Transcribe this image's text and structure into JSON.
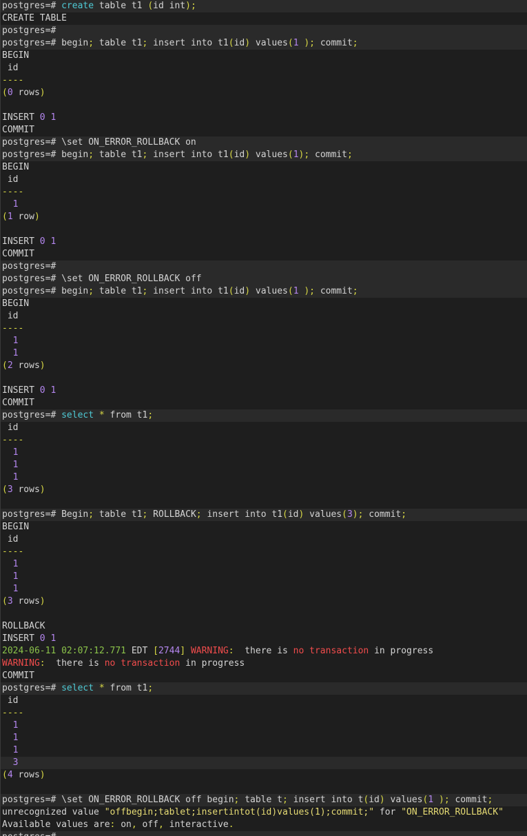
{
  "colors": {
    "background": "#1e1e1e",
    "highlight_row": "#2a2a2a",
    "text": "#d4d4d4",
    "keyword": "#4ec9d4",
    "punctuation": "#d8d845",
    "number": "#b587f0",
    "warning": "#f14c4c",
    "timestamp": "#8bc34a"
  },
  "lines": [
    {
      "hl": true,
      "segs": [
        [
          "prompt",
          "postgres=# "
        ],
        [
          "kw",
          "create"
        ],
        [
          "text",
          " table t1 "
        ],
        [
          "punct",
          "("
        ],
        [
          "text",
          "id int"
        ],
        [
          "punct",
          ");"
        ]
      ]
    },
    {
      "hl": false,
      "segs": [
        [
          "text",
          "CREATE TABLE"
        ]
      ]
    },
    {
      "hl": true,
      "segs": [
        [
          "prompt",
          "postgres=# "
        ]
      ]
    },
    {
      "hl": true,
      "segs": [
        [
          "prompt",
          "postgres=# "
        ],
        [
          "text",
          "begin"
        ],
        [
          "punct",
          ";"
        ],
        [
          "text",
          " table t1"
        ],
        [
          "punct",
          ";"
        ],
        [
          "text",
          " insert into t1"
        ],
        [
          "punct",
          "("
        ],
        [
          "text",
          "id"
        ],
        [
          "punct",
          ")"
        ],
        [
          "text",
          " values"
        ],
        [
          "punct",
          "("
        ],
        [
          "num",
          "1"
        ],
        [
          "punct",
          " );"
        ],
        [
          "text",
          " commit"
        ],
        [
          "punct",
          ";"
        ]
      ]
    },
    {
      "hl": false,
      "segs": [
        [
          "text",
          "BEGIN"
        ]
      ]
    },
    {
      "hl": false,
      "segs": [
        [
          "text",
          " id"
        ]
      ]
    },
    {
      "hl": false,
      "segs": [
        [
          "dim",
          "----"
        ]
      ]
    },
    {
      "hl": false,
      "segs": [
        [
          "punct",
          "("
        ],
        [
          "num",
          "0"
        ],
        [
          "text",
          " rows"
        ],
        [
          "punct",
          ")"
        ]
      ]
    },
    {
      "hl": false,
      "segs": [
        [
          "text",
          ""
        ]
      ]
    },
    {
      "hl": false,
      "segs": [
        [
          "text",
          "INSERT "
        ],
        [
          "num",
          "0 1"
        ]
      ]
    },
    {
      "hl": false,
      "segs": [
        [
          "text",
          "COMMIT"
        ]
      ]
    },
    {
      "hl": true,
      "segs": [
        [
          "prompt",
          "postgres=# "
        ],
        [
          "text",
          "\\set ON_ERROR_ROLLBACK on"
        ]
      ]
    },
    {
      "hl": true,
      "segs": [
        [
          "prompt",
          "postgres=# "
        ],
        [
          "text",
          "begin"
        ],
        [
          "punct",
          ";"
        ],
        [
          "text",
          " table t1"
        ],
        [
          "punct",
          ";"
        ],
        [
          "text",
          " insert into t1"
        ],
        [
          "punct",
          "("
        ],
        [
          "text",
          "id"
        ],
        [
          "punct",
          ")"
        ],
        [
          "text",
          " values"
        ],
        [
          "punct",
          "("
        ],
        [
          "num",
          "1"
        ],
        [
          "punct",
          ");"
        ],
        [
          "text",
          " commit"
        ],
        [
          "punct",
          ";"
        ]
      ]
    },
    {
      "hl": false,
      "segs": [
        [
          "text",
          "BEGIN"
        ]
      ]
    },
    {
      "hl": false,
      "segs": [
        [
          "text",
          " id"
        ]
      ]
    },
    {
      "hl": false,
      "segs": [
        [
          "dim",
          "----"
        ]
      ]
    },
    {
      "hl": false,
      "segs": [
        [
          "num",
          "  1"
        ]
      ]
    },
    {
      "hl": false,
      "segs": [
        [
          "punct",
          "("
        ],
        [
          "num",
          "1"
        ],
        [
          "text",
          " row"
        ],
        [
          "punct",
          ")"
        ]
      ]
    },
    {
      "hl": false,
      "segs": [
        [
          "text",
          ""
        ]
      ]
    },
    {
      "hl": false,
      "segs": [
        [
          "text",
          "INSERT "
        ],
        [
          "num",
          "0 1"
        ]
      ]
    },
    {
      "hl": false,
      "segs": [
        [
          "text",
          "COMMIT"
        ]
      ]
    },
    {
      "hl": true,
      "segs": [
        [
          "prompt",
          "postgres=# "
        ]
      ]
    },
    {
      "hl": true,
      "segs": [
        [
          "prompt",
          "postgres=# "
        ],
        [
          "text",
          "\\set ON_ERROR_ROLLBACK off"
        ]
      ]
    },
    {
      "hl": true,
      "segs": [
        [
          "prompt",
          "postgres=# "
        ],
        [
          "text",
          "begin"
        ],
        [
          "punct",
          ";"
        ],
        [
          "text",
          " table t1"
        ],
        [
          "punct",
          ";"
        ],
        [
          "text",
          " insert into t1"
        ],
        [
          "punct",
          "("
        ],
        [
          "text",
          "id"
        ],
        [
          "punct",
          ")"
        ],
        [
          "text",
          " values"
        ],
        [
          "punct",
          "("
        ],
        [
          "num",
          "1"
        ],
        [
          "punct",
          " );"
        ],
        [
          "text",
          " commit"
        ],
        [
          "punct",
          ";"
        ]
      ]
    },
    {
      "hl": false,
      "segs": [
        [
          "text",
          "BEGIN"
        ]
      ]
    },
    {
      "hl": false,
      "segs": [
        [
          "text",
          " id"
        ]
      ]
    },
    {
      "hl": false,
      "segs": [
        [
          "dim",
          "----"
        ]
      ]
    },
    {
      "hl": false,
      "segs": [
        [
          "num",
          "  1"
        ]
      ]
    },
    {
      "hl": false,
      "segs": [
        [
          "num",
          "  1"
        ]
      ]
    },
    {
      "hl": false,
      "segs": [
        [
          "punct",
          "("
        ],
        [
          "num",
          "2"
        ],
        [
          "text",
          " rows"
        ],
        [
          "punct",
          ")"
        ]
      ]
    },
    {
      "hl": false,
      "segs": [
        [
          "text",
          ""
        ]
      ]
    },
    {
      "hl": false,
      "segs": [
        [
          "text",
          "INSERT "
        ],
        [
          "num",
          "0 1"
        ]
      ]
    },
    {
      "hl": false,
      "segs": [
        [
          "text",
          "COMMIT"
        ]
      ]
    },
    {
      "hl": true,
      "segs": [
        [
          "prompt",
          "postgres=# "
        ],
        [
          "kw",
          "select"
        ],
        [
          "text",
          " "
        ],
        [
          "punct",
          "*"
        ],
        [
          "text",
          " from t1"
        ],
        [
          "punct",
          ";"
        ]
      ]
    },
    {
      "hl": false,
      "segs": [
        [
          "text",
          " id"
        ]
      ]
    },
    {
      "hl": false,
      "segs": [
        [
          "dim",
          "----"
        ]
      ]
    },
    {
      "hl": false,
      "segs": [
        [
          "num",
          "  1"
        ]
      ]
    },
    {
      "hl": false,
      "segs": [
        [
          "num",
          "  1"
        ]
      ]
    },
    {
      "hl": false,
      "segs": [
        [
          "num",
          "  1"
        ]
      ]
    },
    {
      "hl": false,
      "segs": [
        [
          "punct",
          "("
        ],
        [
          "num",
          "3"
        ],
        [
          "text",
          " rows"
        ],
        [
          "punct",
          ")"
        ]
      ]
    },
    {
      "hl": false,
      "segs": [
        [
          "text",
          ""
        ]
      ]
    },
    {
      "hl": true,
      "segs": [
        [
          "prompt",
          "postgres=# "
        ],
        [
          "text",
          "Begin"
        ],
        [
          "punct",
          ";"
        ],
        [
          "text",
          " table t1"
        ],
        [
          "punct",
          ";"
        ],
        [
          "text",
          " ROLLBACK"
        ],
        [
          "punct",
          ";"
        ],
        [
          "text",
          " insert into t1"
        ],
        [
          "punct",
          "("
        ],
        [
          "text",
          "id"
        ],
        [
          "punct",
          ")"
        ],
        [
          "text",
          " values"
        ],
        [
          "punct",
          "("
        ],
        [
          "num",
          "3"
        ],
        [
          "punct",
          ");"
        ],
        [
          "text",
          " commit"
        ],
        [
          "punct",
          ";"
        ]
      ]
    },
    {
      "hl": false,
      "segs": [
        [
          "text",
          "BEGIN"
        ]
      ]
    },
    {
      "hl": false,
      "segs": [
        [
          "text",
          " id"
        ]
      ]
    },
    {
      "hl": false,
      "segs": [
        [
          "dim",
          "----"
        ]
      ]
    },
    {
      "hl": false,
      "segs": [
        [
          "num",
          "  1"
        ]
      ]
    },
    {
      "hl": false,
      "segs": [
        [
          "num",
          "  1"
        ]
      ]
    },
    {
      "hl": false,
      "segs": [
        [
          "num",
          "  1"
        ]
      ]
    },
    {
      "hl": false,
      "segs": [
        [
          "punct",
          "("
        ],
        [
          "num",
          "3"
        ],
        [
          "text",
          " rows"
        ],
        [
          "punct",
          ")"
        ]
      ]
    },
    {
      "hl": false,
      "segs": [
        [
          "text",
          ""
        ]
      ]
    },
    {
      "hl": false,
      "segs": [
        [
          "text",
          "ROLLBACK"
        ]
      ]
    },
    {
      "hl": false,
      "segs": [
        [
          "text",
          "INSERT "
        ],
        [
          "num",
          "0 1"
        ]
      ]
    },
    {
      "hl": false,
      "segs": [
        [
          "ts",
          "2024-06-11 02:07:12.771"
        ],
        [
          "text",
          " EDT "
        ],
        [
          "punct",
          "["
        ],
        [
          "num",
          "2744"
        ],
        [
          "punct",
          "]"
        ],
        [
          "text",
          " "
        ],
        [
          "warn",
          "WARNING"
        ],
        [
          "punct",
          ":"
        ],
        [
          "text",
          "  there is "
        ],
        [
          "warn",
          "no transaction"
        ],
        [
          "text",
          " in progress"
        ]
      ]
    },
    {
      "hl": false,
      "segs": [
        [
          "warn",
          "WARNING"
        ],
        [
          "punct",
          ":"
        ],
        [
          "text",
          "  there is "
        ],
        [
          "warn",
          "no transaction"
        ],
        [
          "text",
          " in progress"
        ]
      ]
    },
    {
      "hl": false,
      "segs": [
        [
          "text",
          "COMMIT"
        ]
      ]
    },
    {
      "hl": true,
      "segs": [
        [
          "prompt",
          "postgres=# "
        ],
        [
          "kw",
          "select"
        ],
        [
          "text",
          " "
        ],
        [
          "punct",
          "*"
        ],
        [
          "text",
          " from t1"
        ],
        [
          "punct",
          ";"
        ]
      ]
    },
    {
      "hl": false,
      "segs": [
        [
          "text",
          " id"
        ]
      ]
    },
    {
      "hl": false,
      "segs": [
        [
          "dim",
          "----"
        ]
      ]
    },
    {
      "hl": false,
      "segs": [
        [
          "num",
          "  1"
        ]
      ]
    },
    {
      "hl": false,
      "segs": [
        [
          "num",
          "  1"
        ]
      ]
    },
    {
      "hl": false,
      "segs": [
        [
          "num",
          "  1"
        ]
      ]
    },
    {
      "hl": true,
      "segs": [
        [
          "num",
          "  3"
        ]
      ]
    },
    {
      "hl": false,
      "segs": [
        [
          "punct",
          "("
        ],
        [
          "num",
          "4"
        ],
        [
          "text",
          " rows"
        ],
        [
          "punct",
          ")"
        ]
      ]
    },
    {
      "hl": false,
      "segs": [
        [
          "text",
          ""
        ]
      ]
    },
    {
      "hl": true,
      "segs": [
        [
          "prompt",
          "postgres=# "
        ],
        [
          "text",
          "\\set ON_ERROR_ROLLBACK off begin"
        ],
        [
          "punct",
          ";"
        ],
        [
          "text",
          " table t"
        ],
        [
          "punct",
          ";"
        ],
        [
          "text",
          " insert into t"
        ],
        [
          "punct",
          "("
        ],
        [
          "text",
          "id"
        ],
        [
          "punct",
          ")"
        ],
        [
          "text",
          " values"
        ],
        [
          "punct",
          "("
        ],
        [
          "num",
          "1"
        ],
        [
          "punct",
          " );"
        ],
        [
          "text",
          " commit"
        ],
        [
          "punct",
          ";"
        ]
      ]
    },
    {
      "hl": false,
      "segs": [
        [
          "text",
          "unrecognized value "
        ],
        [
          "str",
          "\"offbegin;tablet;insertintot(id)values(1);commit;\""
        ],
        [
          "text",
          " for "
        ],
        [
          "str",
          "\"ON_ERROR_ROLLBACK\""
        ]
      ]
    },
    {
      "hl": false,
      "segs": [
        [
          "text",
          "Available values are"
        ],
        [
          "punct",
          ":"
        ],
        [
          "text",
          " on"
        ],
        [
          "punct",
          ","
        ],
        [
          "text",
          " off"
        ],
        [
          "punct",
          ","
        ],
        [
          "text",
          " interactive"
        ],
        [
          "punct",
          "."
        ]
      ]
    },
    {
      "hl": true,
      "segs": [
        [
          "prompt",
          "postgres=# "
        ]
      ]
    }
  ]
}
